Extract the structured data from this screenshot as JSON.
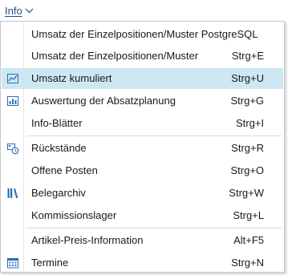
{
  "menubar": {
    "title": "Info",
    "chevron_icon": "chevron-down-icon"
  },
  "menu": {
    "items": [
      {
        "label": "Umsatz der Einzelpositionen/Muster PostgreSQL",
        "shortcut": "",
        "icon": ""
      },
      {
        "label": "Umsatz der Einzelpositionen/Muster",
        "shortcut": "Strg+E",
        "icon": ""
      },
      {
        "label": "Umsatz kumuliert",
        "shortcut": "Strg+U",
        "icon": "line-chart-icon",
        "highlighted": true
      },
      {
        "label": "Auswertung der Absatzplanung",
        "shortcut": "Strg+G",
        "icon": "bar-chart-icon"
      },
      {
        "label": "Info-Blätter",
        "shortcut": "Strg+I",
        "icon": ""
      },
      {
        "label": "Rückstände",
        "shortcut": "Strg+R",
        "icon": "backorder-icon"
      },
      {
        "label": "Offene Posten",
        "shortcut": "Strg+O",
        "icon": ""
      },
      {
        "label": "Belegarchiv",
        "shortcut": "Strg+W",
        "icon": "archive-icon"
      },
      {
        "label": "Kommissionslager",
        "shortcut": "Strg+L",
        "icon": ""
      },
      {
        "label": "Artikel-Preis-Information",
        "shortcut": "Alt+F5",
        "icon": ""
      },
      {
        "label": "Termine",
        "shortcut": "Strg+N",
        "icon": "calendar-icon"
      }
    ]
  },
  "colors": {
    "highlight": "#cde8f3",
    "menubar_text": "#1f4e8c",
    "icon_blue": "#2b6cb5"
  }
}
